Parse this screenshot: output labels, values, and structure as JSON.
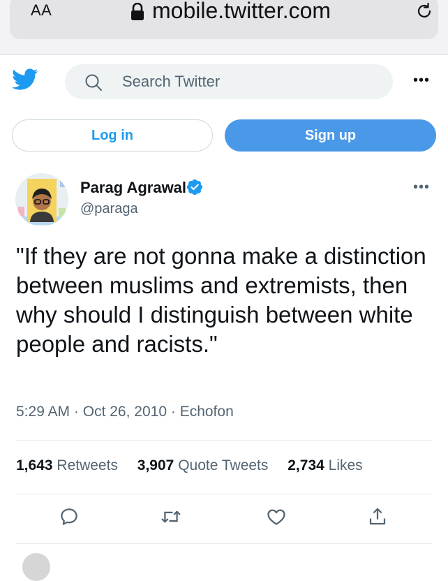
{
  "browser": {
    "aa_label": "AA",
    "url": "mobile.twitter.com"
  },
  "header": {
    "search_placeholder": "Search Twitter",
    "more_label": "•••"
  },
  "auth": {
    "login_label": "Log in",
    "signup_label": "Sign up"
  },
  "tweet": {
    "author_name": "Parag Agrawal",
    "author_handle": "@paraga",
    "more_label": "•••",
    "text": "\"If they are not gonna make a distinction between muslims and extremists, then why should I distinguish between white people and racists.\"",
    "time": "5:29 AM",
    "date": "Oct 26, 2010",
    "source": "Echofon",
    "separator": "·",
    "stats": {
      "retweets_count": "1,643",
      "retweets_label": "Retweets",
      "quote_count": "3,907",
      "quote_label": "Quote Tweets",
      "likes_count": "2,734",
      "likes_label": "Likes"
    }
  },
  "colors": {
    "brand": "#1d9bf0",
    "signup_bg": "#4a99e9",
    "muted_text": "#536471",
    "search_bg": "#eff3f4"
  },
  "icons": [
    "lock-icon",
    "reload-icon",
    "twitter-logo-icon",
    "search-icon",
    "verified-badge-icon",
    "reply-icon",
    "retweet-icon",
    "like-icon",
    "share-icon"
  ]
}
